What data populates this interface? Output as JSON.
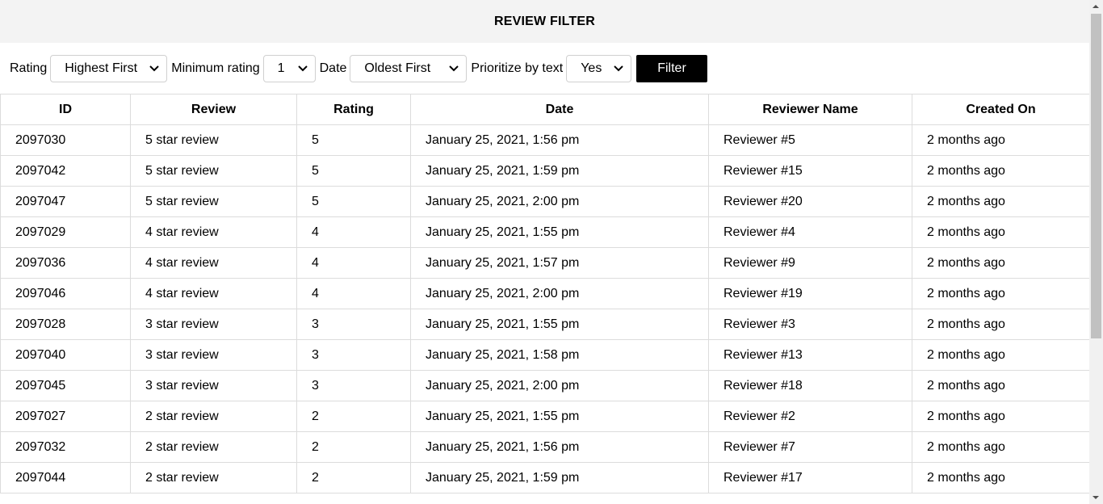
{
  "header": {
    "title": "REVIEW FILTER"
  },
  "filters": {
    "rating_label": "Rating",
    "rating_value": "Highest First",
    "min_rating_label": "Minimum rating",
    "min_rating_value": "1",
    "date_label": "Date",
    "date_value": "Oldest First",
    "prioritize_label": "Prioritize by text",
    "prioritize_value": "Yes",
    "filter_button": "Filter"
  },
  "table": {
    "columns": [
      "ID",
      "Review",
      "Rating",
      "Date",
      "Reviewer Name",
      "Created On"
    ],
    "rows": [
      [
        "2097030",
        "5 star review",
        "5",
        "January 25, 2021, 1:56 pm",
        "Reviewer #5",
        "2 months ago"
      ],
      [
        "2097042",
        "5 star review",
        "5",
        "January 25, 2021, 1:59 pm",
        "Reviewer #15",
        "2 months ago"
      ],
      [
        "2097047",
        "5 star review",
        "5",
        "January 25, 2021, 2:00 pm",
        "Reviewer #20",
        "2 months ago"
      ],
      [
        "2097029",
        "4 star review",
        "4",
        "January 25, 2021, 1:55 pm",
        "Reviewer #4",
        "2 months ago"
      ],
      [
        "2097036",
        "4 star review",
        "4",
        "January 25, 2021, 1:57 pm",
        "Reviewer #9",
        "2 months ago"
      ],
      [
        "2097046",
        "4 star review",
        "4",
        "January 25, 2021, 2:00 pm",
        "Reviewer #19",
        "2 months ago"
      ],
      [
        "2097028",
        "3 star review",
        "3",
        "January 25, 2021, 1:55 pm",
        "Reviewer #3",
        "2 months ago"
      ],
      [
        "2097040",
        "3 star review",
        "3",
        "January 25, 2021, 1:58 pm",
        "Reviewer #13",
        "2 months ago"
      ],
      [
        "2097045",
        "3 star review",
        "3",
        "January 25, 2021, 2:00 pm",
        "Reviewer #18",
        "2 months ago"
      ],
      [
        "2097027",
        "2 star review",
        "2",
        "January 25, 2021, 1:55 pm",
        "Reviewer #2",
        "2 months ago"
      ],
      [
        "2097032",
        "2 star review",
        "2",
        "January 25, 2021, 1:56 pm",
        "Reviewer #7",
        "2 months ago"
      ],
      [
        "2097044",
        "2 star review",
        "2",
        "January 25, 2021, 1:59 pm",
        "Reviewer #17",
        "2 months ago"
      ]
    ]
  },
  "icons": {
    "select_chevron": "chevron-down-icon",
    "scroll_up": "scroll-up-arrow-icon",
    "scroll_down": "scroll-down-arrow-icon"
  }
}
